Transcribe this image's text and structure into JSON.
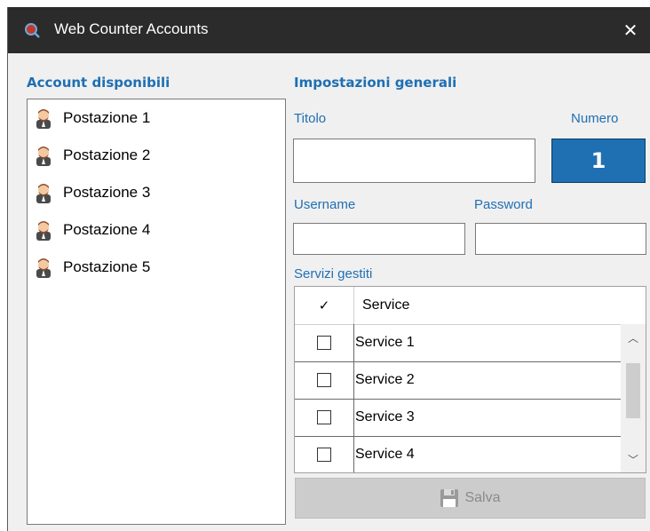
{
  "window": {
    "title": "Web Counter Accounts",
    "close_glyph": "✕",
    "app_icon": "search-icon"
  },
  "accounts": {
    "heading": "Account disponibili",
    "items": [
      {
        "label": "Postazione 1",
        "icon": "user-avatar-icon"
      },
      {
        "label": "Postazione 2",
        "icon": "user-avatar-icon"
      },
      {
        "label": "Postazione 3",
        "icon": "user-avatar-icon"
      },
      {
        "label": "Postazione 4",
        "icon": "user-avatar-icon"
      },
      {
        "label": "Postazione 5",
        "icon": "user-avatar-icon"
      }
    ]
  },
  "settings": {
    "heading": "Impostazioni generali",
    "titolo_label": "Titolo",
    "titolo_value": "",
    "numero_label": "Numero",
    "numero_value": "1",
    "username_label": "Username",
    "username_value": "",
    "password_label": "Password",
    "password_value": "",
    "services_label": "Servizi gestiti"
  },
  "services_grid": {
    "check_header": "✓",
    "service_header": "Service",
    "rows": [
      {
        "name": "Service 1",
        "checked": false
      },
      {
        "name": "Service 2",
        "checked": false
      },
      {
        "name": "Service 3",
        "checked": false
      },
      {
        "name": "Service 4",
        "checked": false
      }
    ],
    "scroll_up_glyph": "︿",
    "scroll_down_glyph": "﹀"
  },
  "save_button": {
    "label": "Salva",
    "icon": "floppy-disk-icon",
    "enabled": false
  },
  "colors": {
    "accent": "#1f6fb3",
    "titlebar": "#2b2b2b",
    "window_bg": "#f0f0f0"
  }
}
